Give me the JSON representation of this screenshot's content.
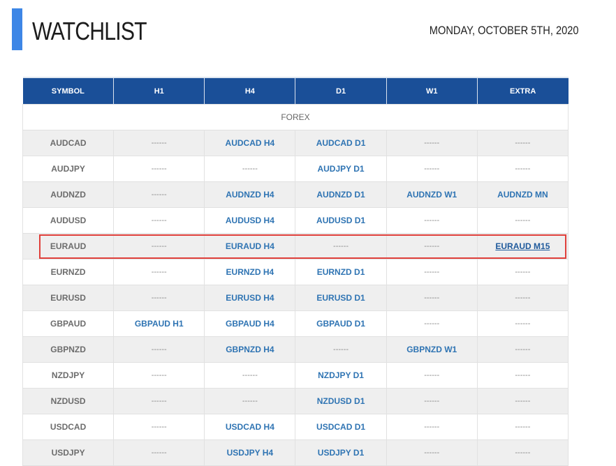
{
  "header": {
    "title": "WATCHLIST",
    "date": "MONDAY, OCTOBER 5TH, 2020"
  },
  "colors": {
    "accent": "#3d86e6",
    "header_bg": "#1a4f98",
    "link": "#2f74b3",
    "highlight": "#e0403b"
  },
  "table": {
    "columns": [
      "SYMBOL",
      "H1",
      "H4",
      "D1",
      "W1",
      "EXTRA"
    ],
    "section": "FOREX",
    "rows": [
      {
        "symbol": "AUDCAD",
        "cells": [
          "------",
          "AUDCAD H4",
          "AUDCAD D1",
          "------",
          "------"
        ]
      },
      {
        "symbol": "AUDJPY",
        "cells": [
          "------",
          "------",
          "AUDJPY D1",
          "------",
          "------"
        ]
      },
      {
        "symbol": "AUDNZD",
        "cells": [
          "------",
          "AUDNZD H4",
          "AUDNZD D1",
          "AUDNZD W1",
          "AUDNZD MN"
        ]
      },
      {
        "symbol": "AUDUSD",
        "cells": [
          "------",
          "AUDUSD H4",
          "AUDUSD D1",
          "------",
          "------"
        ]
      },
      {
        "symbol": "EURAUD",
        "cells": [
          "------",
          "EURAUD H4",
          "------",
          "------",
          "EURAUD M15"
        ]
      },
      {
        "symbol": "EURNZD",
        "cells": [
          "------",
          "EURNZD H4",
          "EURNZD D1",
          "------",
          "------"
        ]
      },
      {
        "symbol": "EURUSD",
        "cells": [
          "------",
          "EURUSD H4",
          "EURUSD D1",
          "------",
          "------"
        ]
      },
      {
        "symbol": "GBPAUD",
        "cells": [
          "GBPAUD H1",
          "GBPAUD H4",
          "GBPAUD D1",
          "------",
          "------"
        ]
      },
      {
        "symbol": "GBPNZD",
        "cells": [
          "------",
          "GBPNZD H4",
          "------",
          "GBPNZD W1",
          "------"
        ]
      },
      {
        "symbol": "NZDJPY",
        "cells": [
          "------",
          "------",
          "NZDJPY D1",
          "------",
          "------"
        ]
      },
      {
        "symbol": "NZDUSD",
        "cells": [
          "------",
          "------",
          "NZDUSD D1",
          "------",
          "------"
        ]
      },
      {
        "symbol": "USDCAD",
        "cells": [
          "------",
          "USDCAD H4",
          "USDCAD D1",
          "------",
          "------"
        ]
      },
      {
        "symbol": "USDJPY",
        "cells": [
          "------",
          "USDJPY H4",
          "USDJPY D1",
          "------",
          "------"
        ]
      }
    ]
  }
}
